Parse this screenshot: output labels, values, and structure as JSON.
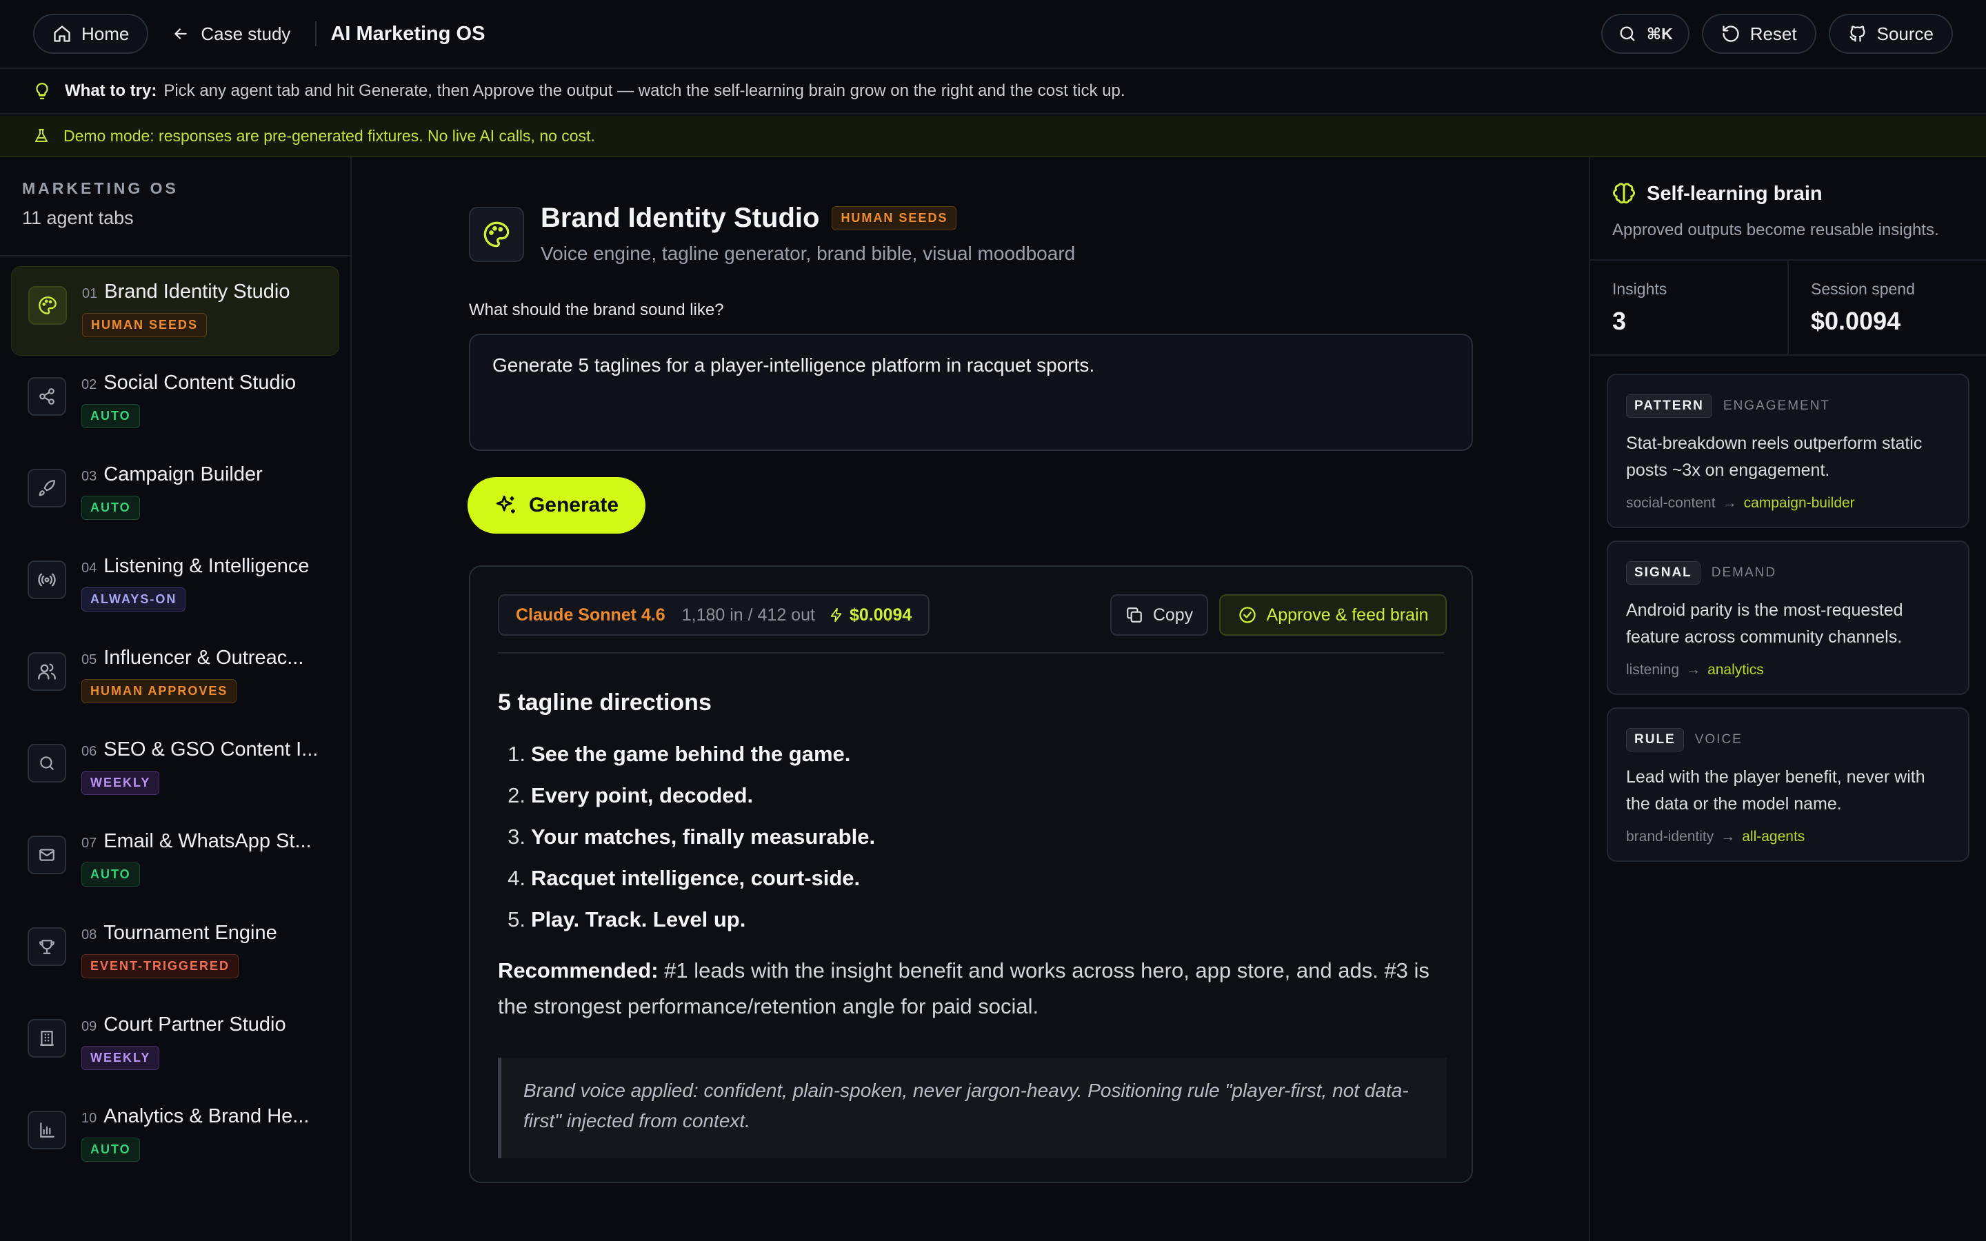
{
  "topbar": {
    "home_label": "Home",
    "back_label": "Case study",
    "app_title": "AI Marketing OS",
    "search_shortcut": "⌘K",
    "reset_label": "Reset",
    "source_label": "Source"
  },
  "tip": {
    "lead": "What to try:",
    "text": "Pick any agent tab and hit Generate, then Approve the output — watch the self-learning brain grow on the right and the cost tick up."
  },
  "demo_notice": "Demo mode: responses are pre-generated fixtures. No live AI calls, no cost.",
  "sidebar": {
    "kicker": "MARKETING OS",
    "count": "11 agent tabs",
    "items": [
      {
        "num": "01",
        "title": "Brand Identity Studio",
        "badge": "HUMAN SEEDS"
      },
      {
        "num": "02",
        "title": "Social Content Studio",
        "badge": "AUTO"
      },
      {
        "num": "03",
        "title": "Campaign Builder",
        "badge": "AUTO"
      },
      {
        "num": "04",
        "title": "Listening & Intelligence",
        "badge": "ALWAYS-ON"
      },
      {
        "num": "05",
        "title": "Influencer & Outreac...",
        "badge": "HUMAN APPROVES"
      },
      {
        "num": "06",
        "title": "SEO & GSO Content I...",
        "badge": "WEEKLY"
      },
      {
        "num": "07",
        "title": "Email & WhatsApp St...",
        "badge": "AUTO"
      },
      {
        "num": "08",
        "title": "Tournament Engine",
        "badge": "EVENT-TRIGGERED"
      },
      {
        "num": "09",
        "title": "Court Partner Studio",
        "badge": "WEEKLY"
      },
      {
        "num": "10",
        "title": "Analytics & Brand He...",
        "badge": "AUTO"
      }
    ]
  },
  "main": {
    "title": "Brand Identity Studio",
    "badge": "HUMAN SEEDS",
    "subtitle": "Voice engine, tagline generator, brand bible, visual moodboard",
    "prompt_label": "What should the brand sound like?",
    "prompt_value": "Generate 5 taglines for a player-intelligence platform in racquet sports.",
    "generate_label": "Generate",
    "output": {
      "model": "Claude Sonnet 4.6",
      "tokens": "1,180 in / 412 out",
      "cost": "$0.0094",
      "copy_label": "Copy",
      "approve_label": "Approve & feed brain",
      "heading": "5 tagline directions",
      "taglines": [
        {
          "n": "1.",
          "text": "See the game behind the game."
        },
        {
          "n": "2.",
          "text": "Every point, decoded."
        },
        {
          "n": "3.",
          "text": "Your matches, finally measurable."
        },
        {
          "n": "4.",
          "text": "Racquet intelligence, court-side."
        },
        {
          "n": "5.",
          "text": "Play. Track. Level up."
        }
      ],
      "rec_lead": "Recommended:",
      "rec_text": " #1 leads with the insight benefit and works across hero, app store, and ads. #3 is the strongest performance/retention angle for paid social.",
      "quote": "Brand voice applied: confident, plain-spoken, never jargon-heavy. Positioning rule \"player-first, not data-first\" injected from context."
    }
  },
  "brain": {
    "title": "Self-learning brain",
    "subtitle": "Approved outputs become reusable insights.",
    "insights_label": "Insights",
    "insights_value": "3",
    "spend_label": "Session spend",
    "spend_value": "$0.0094",
    "cards": [
      {
        "kind": "PATTERN",
        "category": "ENGAGEMENT",
        "body": "Stat-breakdown reels outperform static posts ~3x on engagement.",
        "from": "social-content",
        "to": "campaign-builder"
      },
      {
        "kind": "SIGNAL",
        "category": "DEMAND",
        "body": "Android parity is the most-requested feature across community channels.",
        "from": "listening",
        "to": "analytics"
      },
      {
        "kind": "RULE",
        "category": "VOICE",
        "body": "Lead with the player benefit, never with the data or the model name.",
        "from": "brand-identity",
        "to": "all-agents"
      }
    ]
  },
  "colors": {
    "accent": "#d2fa14",
    "background": "#090b10",
    "orange": "#f08a2e",
    "green": "#34d27a"
  }
}
